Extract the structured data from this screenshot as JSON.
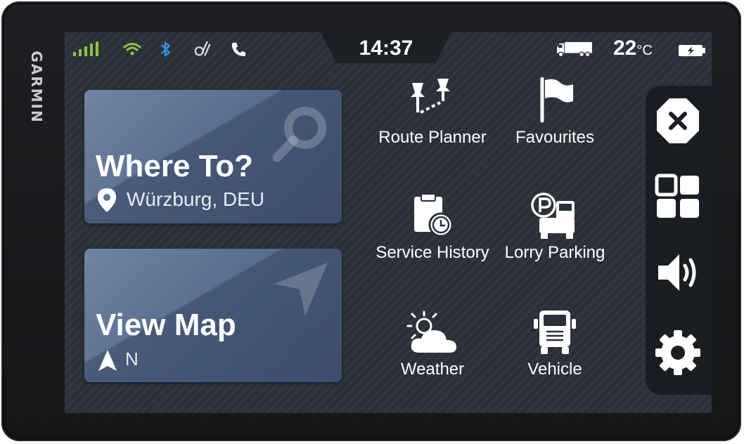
{
  "brand": {
    "name": "GARMIN"
  },
  "status_bar": {
    "time": "14:37",
    "temperature": "22",
    "temperature_unit": "°C",
    "icons": [
      "signal-bars-icon",
      "wifi-icon",
      "bluetooth-icon",
      "drive-app-icon",
      "phone-icon",
      "truck-profile-icon",
      "battery-icon"
    ]
  },
  "cards": {
    "where_to": {
      "title": "Where To?",
      "location": "Würzburg, DEU",
      "icon": "search-icon"
    },
    "view_map": {
      "title": "View Map",
      "heading": "N",
      "icon": "navigation-arrow-icon"
    }
  },
  "menu": [
    {
      "label": "Route Planner",
      "icon": "route-pins-icon"
    },
    {
      "label": "Favourites",
      "icon": "flag-icon"
    },
    {
      "label": "Service History",
      "icon": "clipboard-clock-icon"
    },
    {
      "label": "Lorry Parking",
      "icon": "truck-parking-icon"
    },
    {
      "label": "Weather",
      "icon": "weather-icon"
    },
    {
      "label": "Vehicle",
      "icon": "truck-front-icon"
    }
  ],
  "rail": [
    "close-icon",
    "apps-grid-icon",
    "volume-icon",
    "settings-gear-icon"
  ],
  "colors": {
    "screen_bg": "#2a3038",
    "card": "#5e7393",
    "signal_green": "#8dc63f",
    "bluetooth_blue": "#3a8fe0",
    "rail_bg": "#1a1d22"
  }
}
